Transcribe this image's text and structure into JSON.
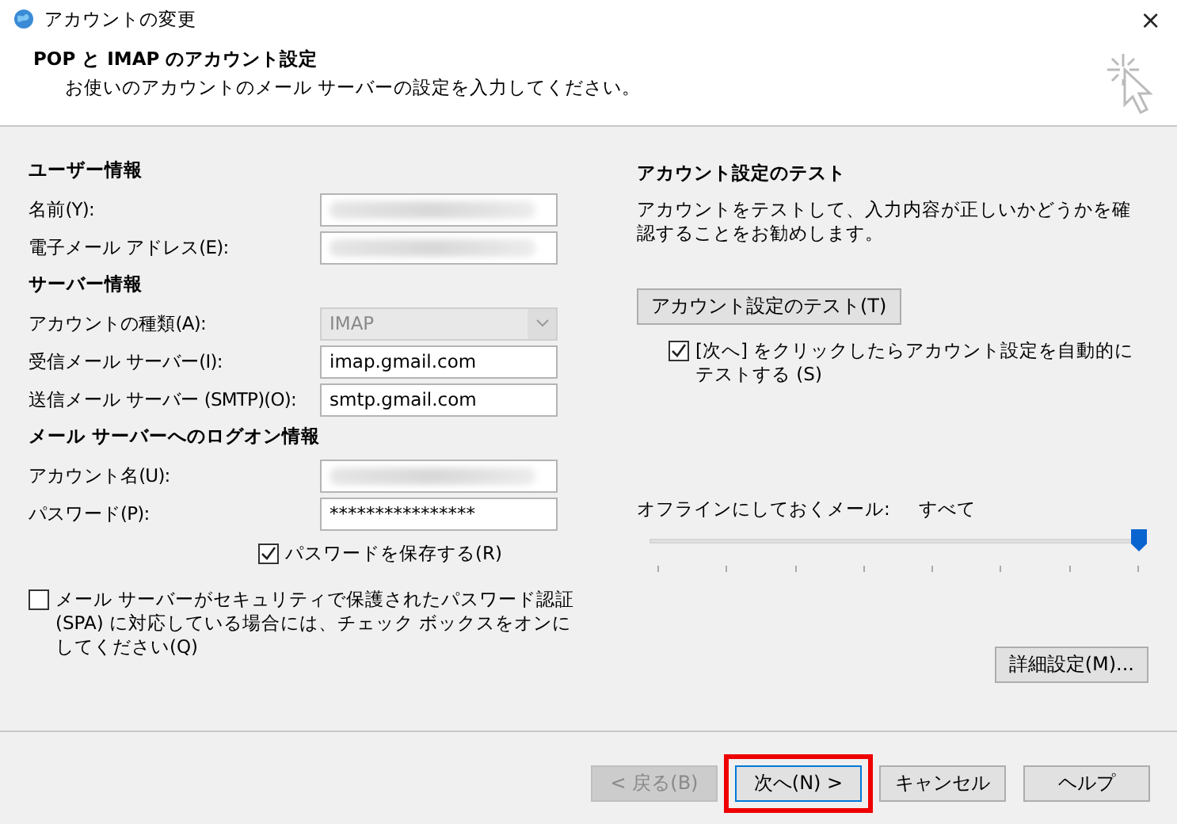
{
  "window": {
    "title": "アカウントの変更",
    "close": "×"
  },
  "header": {
    "title": "POP と IMAP のアカウント設定",
    "subtitle": "お使いのアカウントのメール サーバーの設定を入力してください。"
  },
  "sections": [
    {
      "heading": "ユーザー情報",
      "fields": [
        {
          "label": "名前(Y):",
          "kind": "text",
          "blurred": true
        },
        {
          "label": "電子メール アドレス(E):",
          "kind": "text",
          "blurred": true
        }
      ]
    },
    {
      "heading": "サーバー情報",
      "fields": [
        {
          "label": "アカウントの種類(A):",
          "kind": "select",
          "value": "IMAP",
          "disabled": true
        },
        {
          "label": "受信メール サーバー(I):",
          "kind": "text",
          "value": "imap.gmail.com"
        },
        {
          "label": "送信メール サーバー (SMTP)(O):",
          "kind": "text",
          "value": "smtp.gmail.com"
        }
      ]
    },
    {
      "heading": "メール サーバーへのログオン情報",
      "fields": [
        {
          "label": "アカウント名(U):",
          "kind": "text",
          "blurred": true
        },
        {
          "label": "パスワード(P):",
          "kind": "text",
          "value": "****************"
        }
      ]
    }
  ],
  "remember_password": {
    "label": "パスワードを保存する(R)",
    "checked": true
  },
  "spa": {
    "label": "メール サーバーがセキュリティで保護されたパスワード認証 (SPA) に対応している場合には、チェック ボックスをオンにしてください(Q)",
    "checked": false
  },
  "test": {
    "heading": "アカウント設定のテスト",
    "description": "アカウントをテストして、入力内容が正しいかどうかを確認することをお勧めします。",
    "button": "アカウント設定のテスト(T)",
    "auto_test": {
      "label": "[次へ] をクリックしたらアカウント設定を自動的にテストする (S)",
      "checked": true
    }
  },
  "offline": {
    "label": "オフラインにしておくメール:",
    "value": "すべて",
    "level": 1
  },
  "advanced_button": "詳細設定(M)...",
  "buttons": [
    {
      "label": "< 戻る(B)",
      "disabled": true,
      "highlighted": false
    },
    {
      "label": "次へ(N) >",
      "disabled": false,
      "highlighted": true
    },
    {
      "label": "キャンセル",
      "disabled": false,
      "highlighted": false
    },
    {
      "label": "ヘルプ",
      "disabled": false,
      "highlighted": false
    }
  ]
}
